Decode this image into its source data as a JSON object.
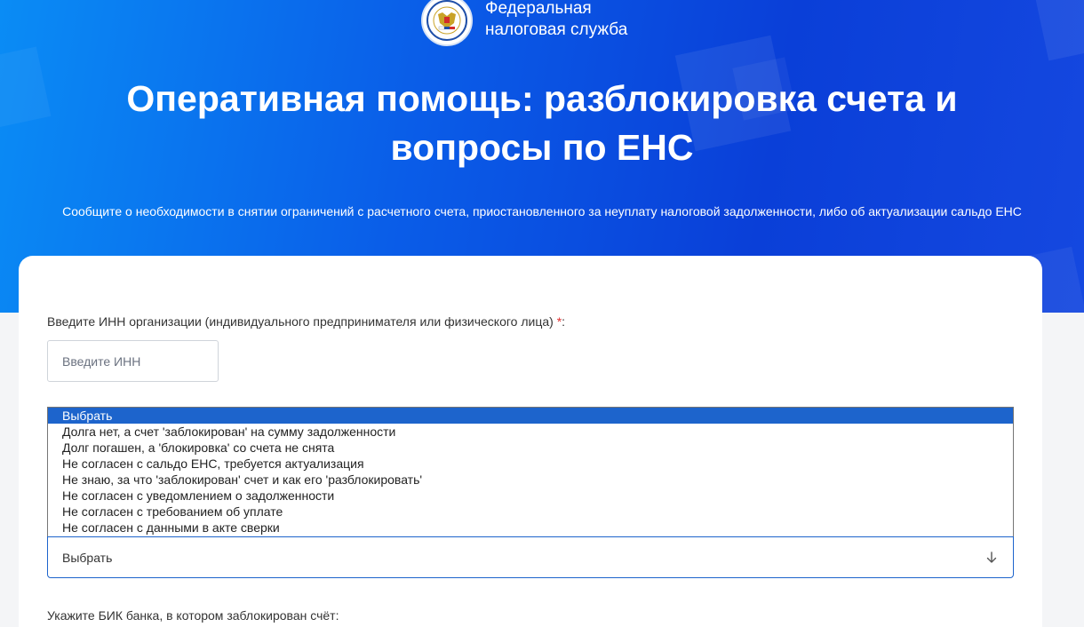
{
  "header": {
    "brand_line1": "Федеральная",
    "brand_line2": "налоговая служба",
    "title": "Оперативная помощь: разблокировка счета и вопросы по ЕНС",
    "subtitle": "Сообщите о необходимости в снятии ограничений с расчетного счета, приостановленного за неуплату налоговой задолженности, либо об актуализации сальдо ЕНС",
    "logo_icon": "fns-emblem-icon"
  },
  "form": {
    "inn_label": "Введите ИНН организации (индивидуального предпринимателя или физического лица)",
    "required_mark": "*",
    "inn_label_suffix": ":",
    "inn_value": "",
    "inn_placeholder": "Введите ИНН",
    "reason_options": [
      "Выбрать",
      "Долга нет, а счет 'заблокирован' на сумму задолженности",
      "Долг погашен, а 'блокировка' со счета не снята",
      "Не согласен с сальдо ЕНС, требуется актуализация",
      "Не знаю, за что 'заблокирован' счет и как его 'разблокировать'",
      "Не согласен с уведомлением о задолженности",
      "Не согласен с требованием об уплате",
      "Не согласен с данными в акте сверки"
    ],
    "reason_selected": "Выбрать",
    "dropdown_icon": "arrow-down-icon",
    "bik_label": "Укажите БИК банка, в котором заблокирован счёт:"
  },
  "colors": {
    "hero_gradient_start": "#0a8cf5",
    "hero_gradient_end": "#0a3fd8",
    "accent": "#1d64cc",
    "required": "#e03030"
  }
}
